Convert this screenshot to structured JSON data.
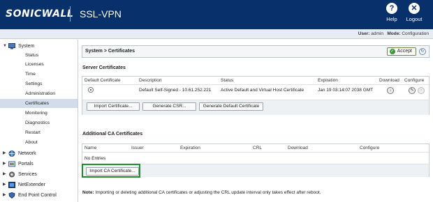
{
  "header": {
    "logo": "SONICWALL",
    "product": "SSL-VPN",
    "help_label": "Help",
    "logout_label": "Logout",
    "help_glyph": "?",
    "logout_glyph": "✕"
  },
  "userbar": {
    "user_label": "User:",
    "user_value": "admin",
    "mode_label": "Mode:",
    "mode_value": "Configuration"
  },
  "sidebar": {
    "system_label": "System",
    "system_items": [
      "Status",
      "Licenses",
      "Time",
      "Settings",
      "Administration",
      "Certificates",
      "Monitoring",
      "Diagnostics",
      "Restart",
      "About"
    ],
    "active_item": "Certificates",
    "other_sections": [
      "Network",
      "Portals",
      "Services",
      "NetExtender",
      "End Point Control"
    ]
  },
  "main": {
    "breadcrumb": "System > Certificates",
    "accept_label": "Accept",
    "server_section": {
      "title": "Server Certificates",
      "headers": [
        "Default Certificate",
        "Description",
        "Status",
        "Expiration",
        "Download",
        "Configure"
      ],
      "row": {
        "description": "Default Self-Signed - 10.61.252.221",
        "status": "Active Default and Virtual Host Certificate",
        "expiration": "Jan 19 03:14:07 2038 GMT"
      },
      "buttons": {
        "import": "Import Certificate...",
        "generate_csr": "Generate CSR...",
        "generate_default": "Generate Default Certificate"
      }
    },
    "ca_section": {
      "title": "Additional CA Certificates",
      "headers": [
        "Name",
        "Issuer",
        "Expiration",
        "CRL",
        "Download",
        "Configure"
      ],
      "empty_text": "No Entries",
      "import_button": "Import CA Certificate..."
    },
    "note": {
      "label": "Note:",
      "text": "Importing or deleting additional CA certificates or adjusting the CRL update interval only takes effect after reboot."
    }
  },
  "colors": {
    "header_bg": "#08306b",
    "active_nav_bg": "#d2dcea",
    "highlight_border": "#1f8a2a"
  }
}
